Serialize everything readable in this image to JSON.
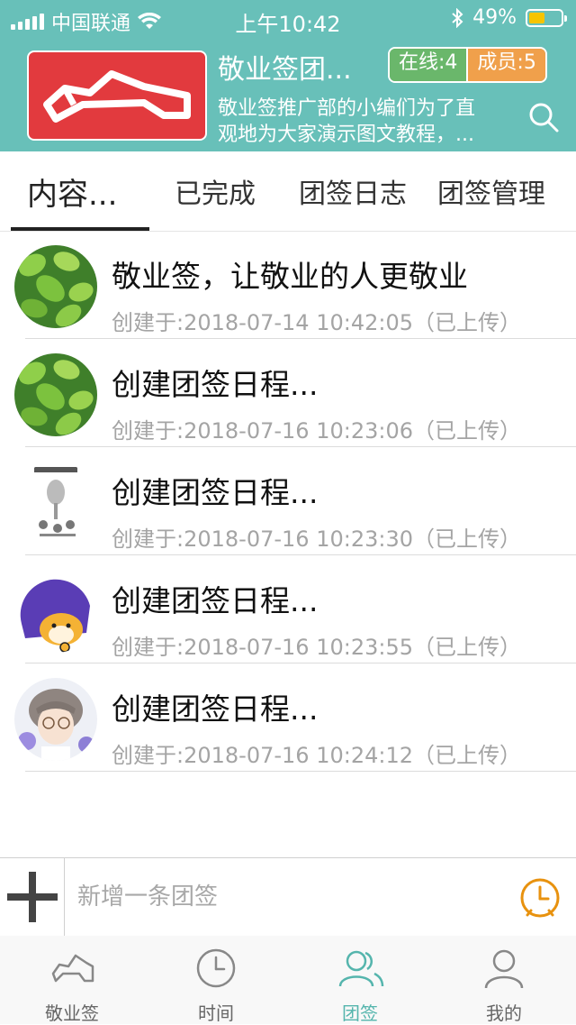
{
  "status_bar": {
    "carrier": "中国联通",
    "time": "上午10:42",
    "battery_percent": "49%",
    "battery_level": 0.49
  },
  "header": {
    "title": "敬业签团...",
    "online_badge": "在线:4",
    "members_badge": "成员:5",
    "description_line1": "敬业签推广部的小编们为了直",
    "description_line2": "观地为大家演示图文教程，..."
  },
  "tabs": [
    {
      "label": "内容...",
      "active": true
    },
    {
      "label": "已完成",
      "active": false
    },
    {
      "label": "团签日志",
      "active": false
    },
    {
      "label": "团签管理",
      "active": false
    }
  ],
  "items": [
    {
      "title": "敬业签，让敬业的人更敬业",
      "meta": "创建于:2018-07-14 10:42:05（已上传）",
      "avatar": "green-leaves-avatar"
    },
    {
      "title": "创建团签日程...",
      "meta": "创建于:2018-07-16 10:23:06（已上传）",
      "avatar": "green-leaves-avatar"
    },
    {
      "title": "创建团签日程...",
      "meta": "创建于:2018-07-16 10:23:30（已上传）",
      "avatar": "sketch-avatar"
    },
    {
      "title": "创建团签日程...",
      "meta": "创建于:2018-07-16 10:23:55（已上传）",
      "avatar": "shiba-helmet-avatar"
    },
    {
      "title": "创建团签日程...",
      "meta": "创建于:2018-07-16 10:24:12（已上传）",
      "avatar": "anime-boy-avatar"
    }
  ],
  "input": {
    "placeholder": "新增一条团签"
  },
  "bottom_nav": [
    {
      "label": "敬业签",
      "icon": "app-logo-icon",
      "active": false
    },
    {
      "label": "时间",
      "icon": "clock-icon",
      "active": false
    },
    {
      "label": "团签",
      "icon": "team-icon",
      "active": true
    },
    {
      "label": "我的",
      "icon": "person-icon",
      "active": false
    }
  ],
  "colors": {
    "header_bg": "#68c0b9",
    "online_badge": "#6ab76b",
    "members_badge": "#f0a04b",
    "logo_red": "#e23a3e",
    "accent_orange": "#e8920f",
    "nav_active": "#55b5ad"
  }
}
